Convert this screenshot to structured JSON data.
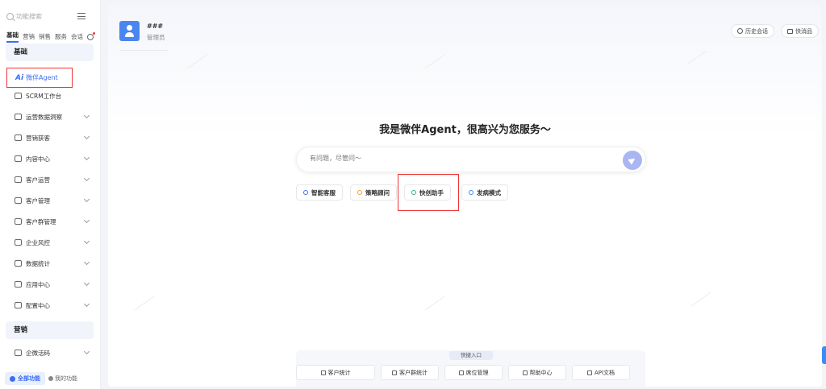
{
  "sidebar": {
    "search_placeholder": "功能搜索",
    "categories": [
      "基础",
      "营销",
      "销售",
      "服务",
      "会话"
    ],
    "section_basic": "基础",
    "agent_item": {
      "prefix": "Ai",
      "label": "微伴Agent"
    },
    "items": [
      {
        "label": "SCRM工作台",
        "chevron": false
      },
      {
        "label": "运营数据洞察",
        "chevron": true
      },
      {
        "label": "营销获客",
        "chevron": true
      },
      {
        "label": "内容中心",
        "chevron": true
      },
      {
        "label": "客户运营",
        "chevron": true
      },
      {
        "label": "客户管理",
        "chevron": true
      },
      {
        "label": "客户群管理",
        "chevron": true
      },
      {
        "label": "企业风控",
        "chevron": true
      },
      {
        "label": "数据统计",
        "chevron": true
      },
      {
        "label": "应用中心",
        "chevron": true
      },
      {
        "label": "配置中心",
        "chevron": true
      }
    ],
    "section_marketing": "营销",
    "marketing_items": [
      {
        "label": "企微活码",
        "chevron": true
      }
    ],
    "bottom": {
      "all_functions": "全部功能",
      "my_functions": "我的功能"
    }
  },
  "header": {
    "user_name": "###",
    "user_role": "管理员",
    "history_button": "历史会话",
    "quick_button": "快消品"
  },
  "main": {
    "headline": "我是微伴Agent，很高兴为您服务～",
    "input_placeholder": "有问题，尽管问～",
    "chips": [
      {
        "label": "智能客服",
        "color": "#3a6cf4"
      },
      {
        "label": "策略顾问",
        "color": "#f0a020"
      },
      {
        "label": "快创助手",
        "color": "#2bb673"
      },
      {
        "label": "发病模式",
        "color": "#3a8cf6"
      }
    ],
    "quick_entry": {
      "title": "快捷入口",
      "items": [
        "客户统计",
        "客户群统计",
        "席位管理",
        "帮助中心",
        "API文档"
      ]
    }
  }
}
